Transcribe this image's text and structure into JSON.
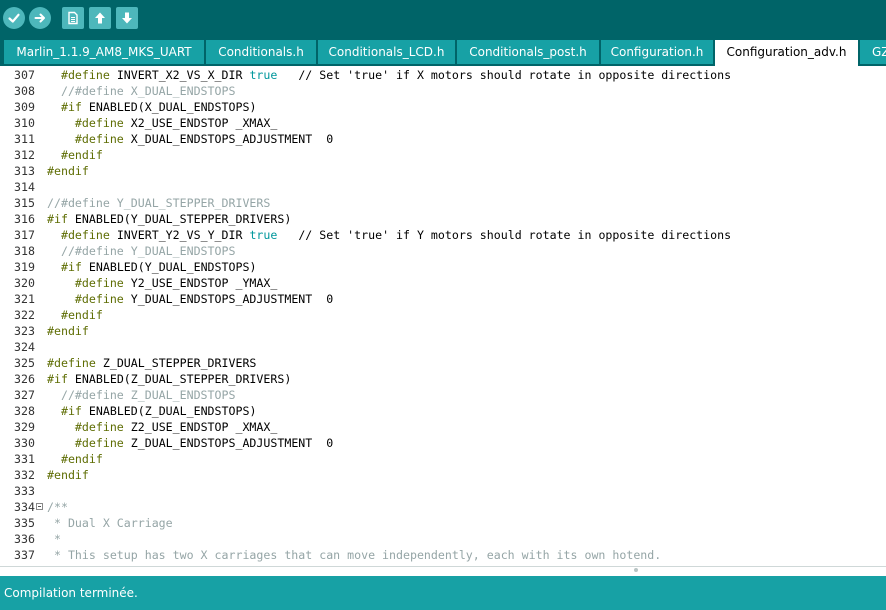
{
  "toolbar": {
    "buttons": [
      {
        "name": "verify-button",
        "icon": "check-icon",
        "shape": "round"
      },
      {
        "name": "upload-button",
        "icon": "arrow-right-icon",
        "shape": "round"
      },
      {
        "name": "new-button",
        "icon": "file-icon",
        "shape": "square"
      },
      {
        "name": "open-button",
        "icon": "arrow-up-icon",
        "shape": "square"
      },
      {
        "name": "save-button",
        "icon": "arrow-down-icon",
        "shape": "square"
      }
    ]
  },
  "tabs": [
    {
      "label": "Marlin_1.1.9_AM8_MKS_UART",
      "active": false
    },
    {
      "label": "Conditionals.h",
      "active": false
    },
    {
      "label": "Conditionals_LCD.h",
      "active": false
    },
    {
      "label": "Conditionals_post.h",
      "active": false
    },
    {
      "label": "Configuration.h",
      "active": false
    },
    {
      "label": "Configuration_adv.h",
      "active": true
    },
    {
      "label": "GZ",
      "active": false
    }
  ],
  "editor": {
    "lines": [
      {
        "n": "307",
        "fold": false,
        "segs": [
          [
            "  ",
            ""
          ],
          [
            "#define",
            "pp"
          ],
          [
            " INVERT_X2_VS_X_DIR ",
            ""
          ],
          [
            "true",
            "true"
          ],
          [
            "   // Set 'true' if X motors should rotate in opposite directions",
            ""
          ]
        ]
      },
      {
        "n": "308",
        "fold": false,
        "segs": [
          [
            "  //#define X_DUAL_ENDSTOPS",
            "cmt"
          ]
        ]
      },
      {
        "n": "309",
        "fold": false,
        "segs": [
          [
            "  ",
            ""
          ],
          [
            "#if",
            "pp"
          ],
          [
            " ENABLED(X_DUAL_ENDSTOPS)",
            ""
          ]
        ]
      },
      {
        "n": "310",
        "fold": false,
        "segs": [
          [
            "    ",
            ""
          ],
          [
            "#define",
            "pp"
          ],
          [
            " X2_USE_ENDSTOP _XMAX_",
            ""
          ]
        ]
      },
      {
        "n": "311",
        "fold": false,
        "segs": [
          [
            "    ",
            ""
          ],
          [
            "#define",
            "pp"
          ],
          [
            " X_DUAL_ENDSTOPS_ADJUSTMENT  0",
            ""
          ]
        ]
      },
      {
        "n": "312",
        "fold": false,
        "segs": [
          [
            "  ",
            ""
          ],
          [
            "#endif",
            "pp"
          ]
        ]
      },
      {
        "n": "313",
        "fold": false,
        "segs": [
          [
            "#endif",
            "pp"
          ]
        ]
      },
      {
        "n": "314",
        "fold": false,
        "segs": []
      },
      {
        "n": "315",
        "fold": false,
        "segs": [
          [
            "//#define Y_DUAL_STEPPER_DRIVERS",
            "cmt"
          ]
        ]
      },
      {
        "n": "316",
        "fold": false,
        "segs": [
          [
            "#if",
            "pp"
          ],
          [
            " ENABLED(Y_DUAL_STEPPER_DRIVERS)",
            ""
          ]
        ]
      },
      {
        "n": "317",
        "fold": false,
        "segs": [
          [
            "  ",
            ""
          ],
          [
            "#define",
            "pp"
          ],
          [
            " INVERT_Y2_VS_Y_DIR ",
            ""
          ],
          [
            "true",
            "true"
          ],
          [
            "   // Set 'true' if Y motors should rotate in opposite directions",
            ""
          ]
        ]
      },
      {
        "n": "318",
        "fold": false,
        "segs": [
          [
            "  //#define Y_DUAL_ENDSTOPS",
            "cmt"
          ]
        ]
      },
      {
        "n": "319",
        "fold": false,
        "segs": [
          [
            "  ",
            ""
          ],
          [
            "#if",
            "pp"
          ],
          [
            " ENABLED(Y_DUAL_ENDSTOPS)",
            ""
          ]
        ]
      },
      {
        "n": "320",
        "fold": false,
        "segs": [
          [
            "    ",
            ""
          ],
          [
            "#define",
            "pp"
          ],
          [
            " Y2_USE_ENDSTOP _YMAX_",
            ""
          ]
        ]
      },
      {
        "n": "321",
        "fold": false,
        "segs": [
          [
            "    ",
            ""
          ],
          [
            "#define",
            "pp"
          ],
          [
            " Y_DUAL_ENDSTOPS_ADJUSTMENT  0",
            ""
          ]
        ]
      },
      {
        "n": "322",
        "fold": false,
        "segs": [
          [
            "  ",
            ""
          ],
          [
            "#endif",
            "pp"
          ]
        ]
      },
      {
        "n": "323",
        "fold": false,
        "segs": [
          [
            "#endif",
            "pp"
          ]
        ]
      },
      {
        "n": "324",
        "fold": false,
        "segs": []
      },
      {
        "n": "325",
        "fold": false,
        "segs": [
          [
            "#define",
            "pp"
          ],
          [
            " Z_DUAL_STEPPER_DRIVERS",
            ""
          ]
        ]
      },
      {
        "n": "326",
        "fold": false,
        "segs": [
          [
            "#if",
            "pp"
          ],
          [
            " ENABLED(Z_DUAL_STEPPER_DRIVERS)",
            ""
          ]
        ]
      },
      {
        "n": "327",
        "fold": false,
        "segs": [
          [
            "  //#define Z_DUAL_ENDSTOPS",
            "cmt"
          ]
        ]
      },
      {
        "n": "328",
        "fold": false,
        "segs": [
          [
            "  ",
            ""
          ],
          [
            "#if",
            "pp"
          ],
          [
            " ENABLED(Z_DUAL_ENDSTOPS)",
            ""
          ]
        ]
      },
      {
        "n": "329",
        "fold": false,
        "segs": [
          [
            "    ",
            ""
          ],
          [
            "#define",
            "pp"
          ],
          [
            " Z2_USE_ENDSTOP _XMAX_",
            ""
          ]
        ]
      },
      {
        "n": "330",
        "fold": false,
        "segs": [
          [
            "    ",
            ""
          ],
          [
            "#define",
            "pp"
          ],
          [
            " Z_DUAL_ENDSTOPS_ADJUSTMENT  0",
            ""
          ]
        ]
      },
      {
        "n": "331",
        "fold": false,
        "segs": [
          [
            "  ",
            ""
          ],
          [
            "#endif",
            "pp"
          ]
        ]
      },
      {
        "n": "332",
        "fold": false,
        "segs": [
          [
            "#endif",
            "pp"
          ]
        ]
      },
      {
        "n": "333",
        "fold": false,
        "segs": []
      },
      {
        "n": "334",
        "fold": true,
        "segs": [
          [
            "/**",
            "cmt"
          ]
        ]
      },
      {
        "n": "335",
        "fold": false,
        "segs": [
          [
            " * Dual X Carriage",
            "cmt"
          ]
        ]
      },
      {
        "n": "336",
        "fold": false,
        "segs": [
          [
            " *",
            "cmt"
          ]
        ]
      },
      {
        "n": "337",
        "fold": false,
        "segs": [
          [
            " * This setup has two X carriages that can move independently, each with its own hotend.",
            "cmt"
          ]
        ]
      }
    ]
  },
  "console": {
    "text": "Compilation terminée."
  }
}
